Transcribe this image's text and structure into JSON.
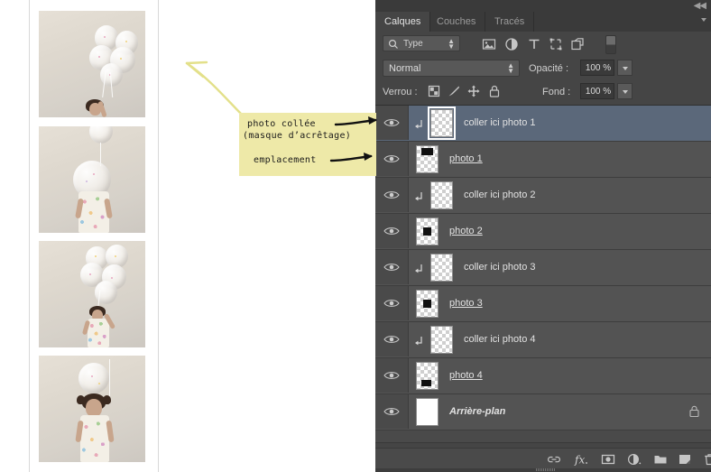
{
  "document": {
    "photos": [
      {
        "name": "photo-thumbnail-1",
        "caption": "enfant avec grappe de ballons"
      },
      {
        "name": "photo-thumbnail-2",
        "caption": "enfant avec gros ballon devant le visage"
      },
      {
        "name": "photo-thumbnail-3",
        "caption": "enfant tenant grappe de ballons"
      },
      {
        "name": "photo-thumbnail-4",
        "caption": "enfant avec un ballon au-dessus de la tete"
      }
    ]
  },
  "annotation": {
    "line1": "photo collée",
    "line2": "(masque d’acrêtage)",
    "line3": "emplacement",
    "background_color": "#eee9a8",
    "arrow_color": "#e3e08a"
  },
  "panel": {
    "collapse_icon": "«",
    "tabs": [
      {
        "label": "Calques",
        "active": true
      },
      {
        "label": "Couches",
        "active": false
      },
      {
        "label": "Tracés",
        "active": false
      }
    ],
    "filter": {
      "search_icon": "search-icon",
      "type_label": "Type",
      "icons": [
        "pixel-filter-icon",
        "adjustment-filter-icon",
        "type-filter-icon",
        "shape-filter-icon",
        "smartobject-filter-icon"
      ],
      "toggle": "filter-toggle-switch"
    },
    "blend": {
      "mode": "Normal",
      "opacity_label": "Opacité :",
      "opacity_value": "100 %"
    },
    "lock": {
      "label": "Verrou :",
      "icons": [
        "lock-transparency-icon",
        "lock-image-icon",
        "lock-position-icon",
        "lock-all-icon"
      ],
      "fill_label": "Fond :",
      "fill_value": "100 %"
    },
    "layers": [
      {
        "name": "coller ici photo 1",
        "style": "clip",
        "selected": true,
        "visible": true,
        "locked": false
      },
      {
        "name": " photo 1 ",
        "style": "mask",
        "selected": false,
        "visible": true,
        "locked": false,
        "mask_pos": "top"
      },
      {
        "name": "coller ici photo 2",
        "style": "clip",
        "selected": false,
        "visible": true,
        "locked": false
      },
      {
        "name": " photo 2 ",
        "style": "mask",
        "selected": false,
        "visible": true,
        "locked": false,
        "mask_pos": "middle"
      },
      {
        "name": "coller ici photo 3",
        "style": "clip",
        "selected": false,
        "visible": true,
        "locked": false
      },
      {
        "name": " photo 3 ",
        "style": "mask",
        "selected": false,
        "visible": true,
        "locked": false,
        "mask_pos": "middle"
      },
      {
        "name": "coller ici photo 4",
        "style": "clip",
        "selected": false,
        "visible": true,
        "locked": false
      },
      {
        "name": " photo 4 ",
        "style": "mask",
        "selected": false,
        "visible": true,
        "locked": false,
        "mask_pos": "bottom"
      },
      {
        "name": "Arrière-plan",
        "style": "background",
        "selected": false,
        "visible": true,
        "locked": true
      }
    ],
    "footer_icons": [
      "link-layers-icon",
      "layer-style-fx-icon",
      "add-layer-mask-icon",
      "new-adjustment-layer-icon",
      "new-group-icon",
      "new-layer-icon",
      "delete-layer-icon"
    ],
    "colors": {
      "panel_bg": "#454545",
      "row_bg": "#535353",
      "row_selected": "#5b687a",
      "eye_column": "#4a4a4a",
      "text": "#e2e2e2"
    }
  }
}
